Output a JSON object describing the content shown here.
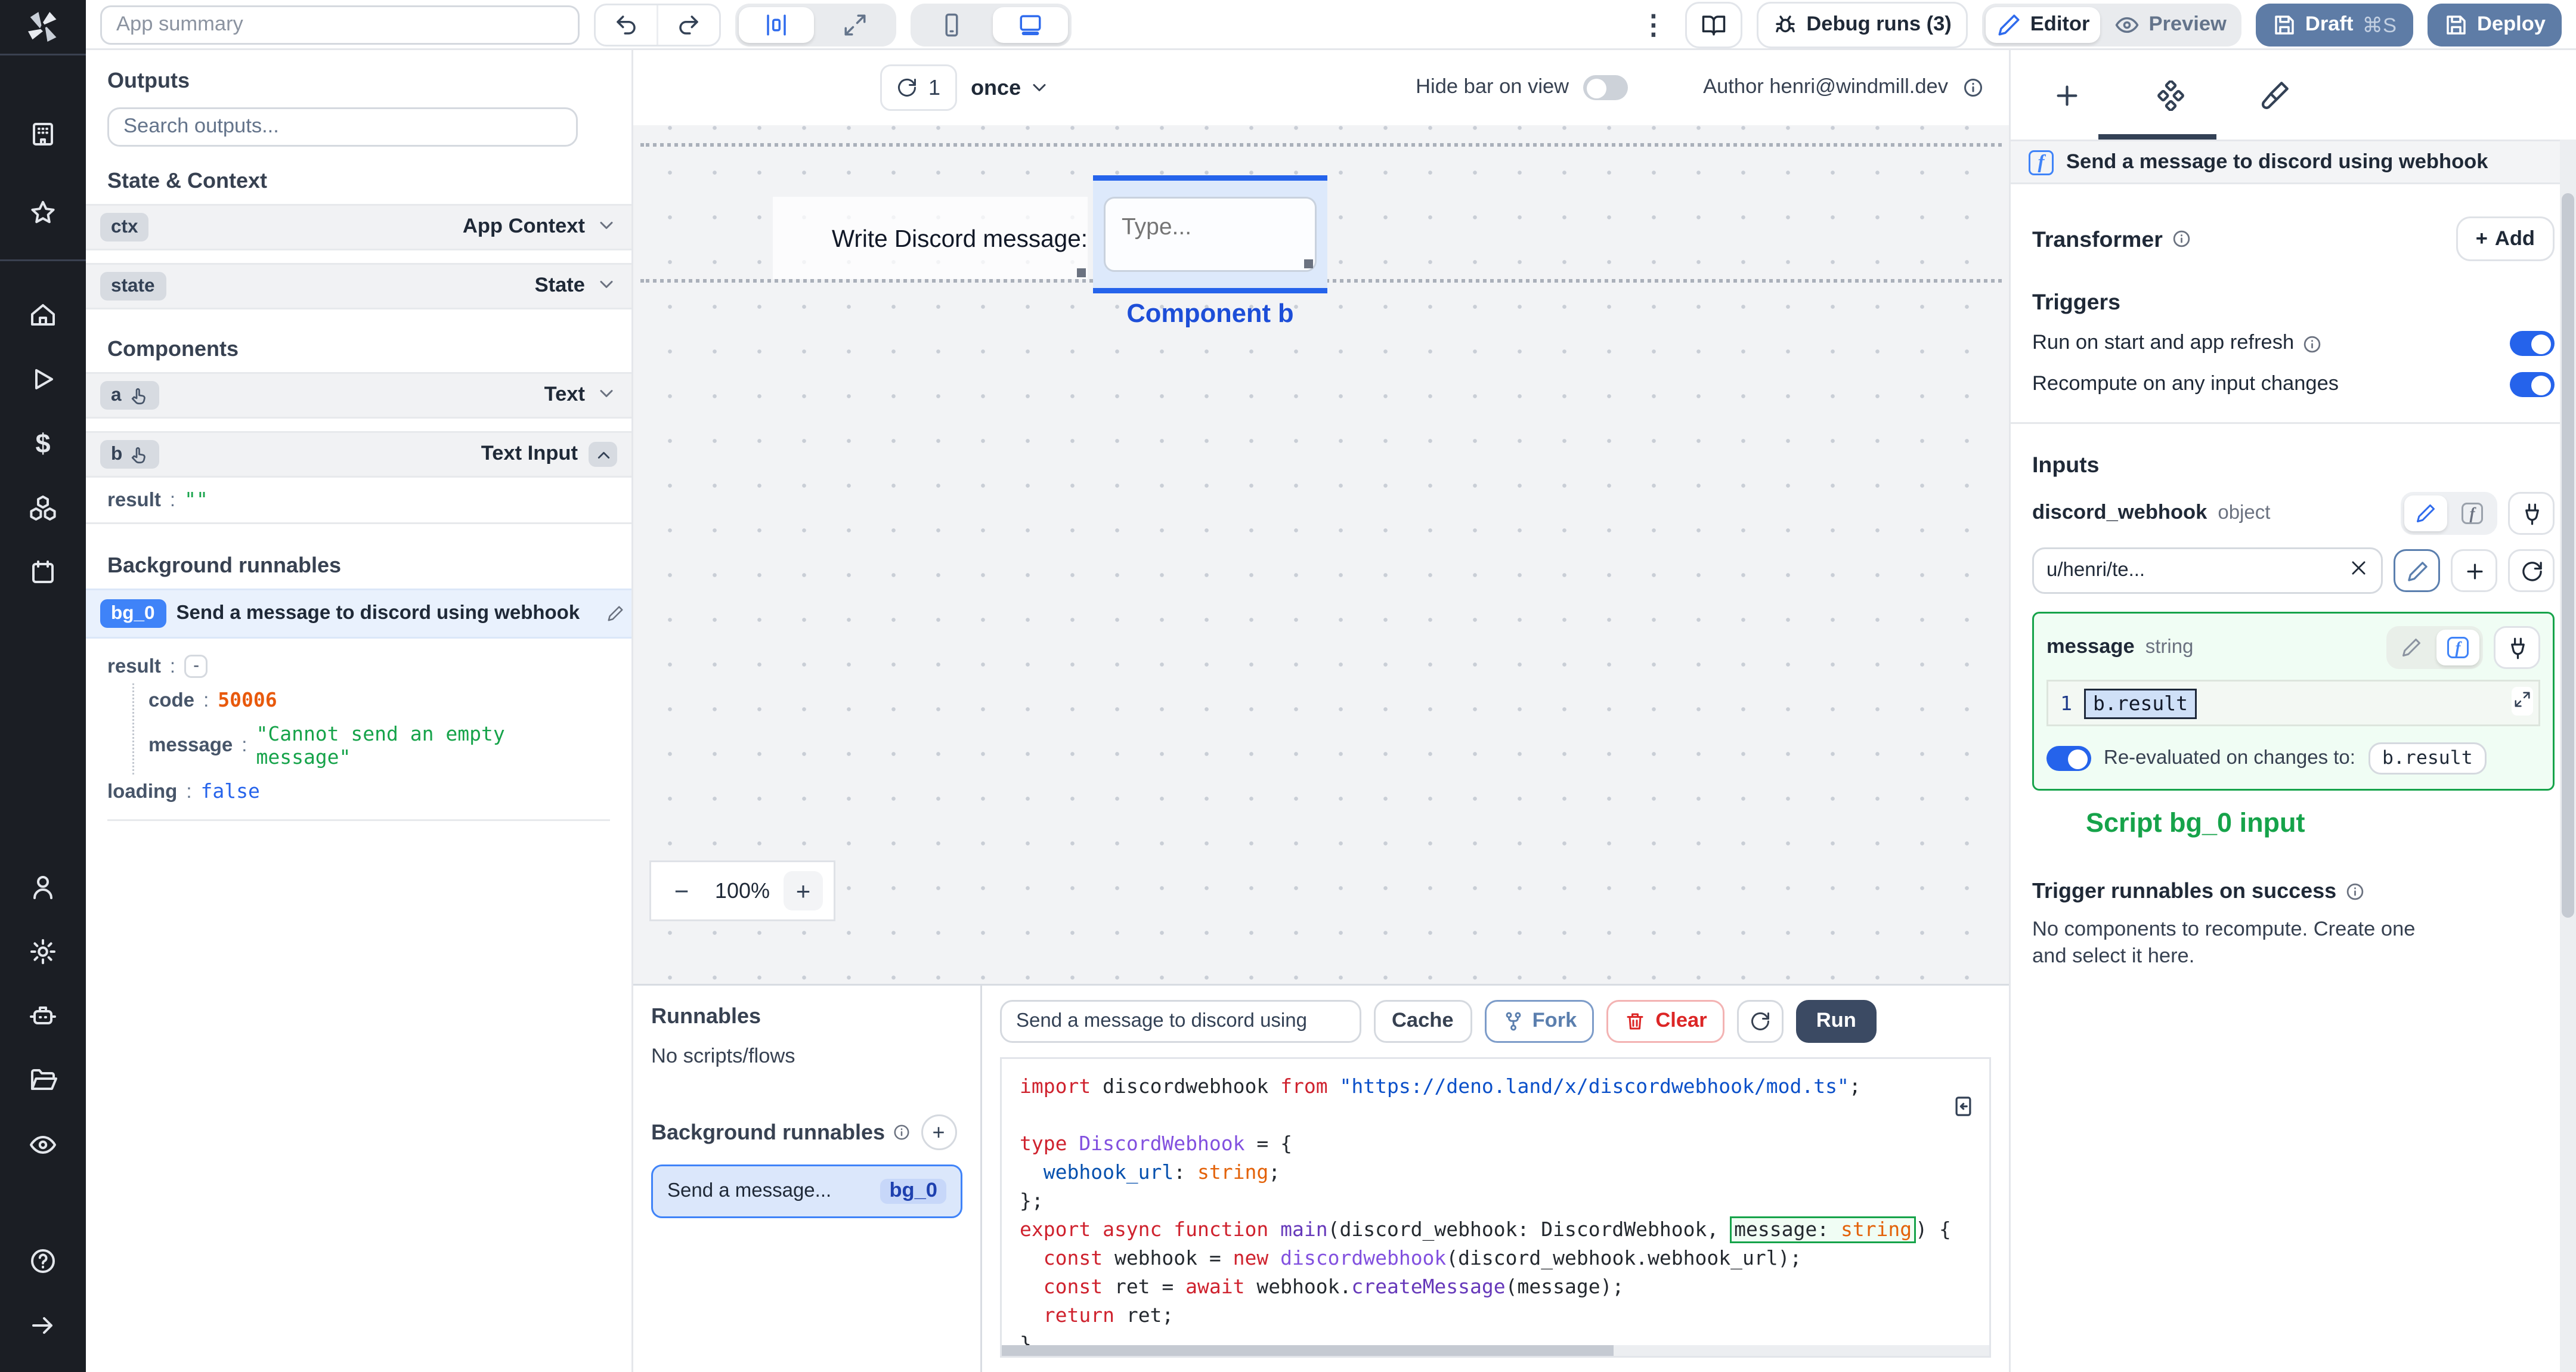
{
  "topbar": {
    "summary_placeholder": "App summary",
    "menu": "⋮",
    "debug_runs_label": "Debug runs (3)",
    "editor_label": "Editor",
    "preview_label": "Preview",
    "draft_label": "Draft",
    "draft_shortcut": "⌘S",
    "deploy_label": "Deploy"
  },
  "left_panel": {
    "outputs_title": "Outputs",
    "search_placeholder": "Search outputs...",
    "state_context_title": "State & Context",
    "ctx": {
      "id": "ctx",
      "type": "App Context"
    },
    "state": {
      "id": "state",
      "type": "State"
    },
    "components_title": "Components",
    "comp_a": {
      "id": "a",
      "type": "Text"
    },
    "comp_b": {
      "id": "b",
      "type": "Text Input"
    },
    "comp_b_result": {
      "key": "result",
      "colon": ":",
      "value": "\"\""
    },
    "background_title": "Background runnables",
    "bg": {
      "badge": "bg_0",
      "title": "Send a message to discord using webhook"
    },
    "bg_result": {
      "key": "result",
      "colon": ":",
      "value": "-"
    },
    "bg_code": {
      "key": "code",
      "colon": ":",
      "value": "50006"
    },
    "bg_message": {
      "key": "message",
      "colon": ":",
      "value": "\"Cannot send an empty message\""
    },
    "bg_loading": {
      "key": "loading",
      "colon": ":",
      "value": "false"
    }
  },
  "canvas": {
    "refresh_count": "1",
    "schedule": "once",
    "hide_bar_label": "Hide bar on view",
    "author_label": "Author henri@windmill.dev",
    "text_component": "Write Discord message:",
    "input_placeholder": "Type...",
    "selected_label": "Component b",
    "zoom_out": "−",
    "zoom_level": "100%",
    "zoom_in": "+"
  },
  "runnables": {
    "title": "Runnables",
    "empty": "No scripts/flows",
    "background_title": "Background runnables",
    "item_label": "Send a message...",
    "item_badge": "bg_0"
  },
  "editor": {
    "script_name": "Send a message to discord using",
    "cache_label": "Cache",
    "fork_label": "Fork",
    "clear_label": "Clear",
    "run_label": "Run"
  },
  "code": {
    "lines": [
      [
        [
          "k",
          "import"
        ],
        [
          "p",
          " discordwebhook "
        ],
        [
          "k",
          "from"
        ],
        [
          "s",
          " \"https://deno.land/x/discordwebhook/mod.ts\""
        ],
        [
          "p",
          ";"
        ]
      ],
      [],
      [
        [
          "k",
          "type"
        ],
        [
          "t",
          " DiscordWebhook"
        ],
        [
          "p",
          " = {"
        ]
      ],
      [
        [
          "v",
          "  webhook_url"
        ],
        [
          "p",
          ": "
        ],
        [
          "ty",
          "string"
        ],
        [
          "p",
          ";"
        ]
      ],
      [
        [
          "p",
          "};"
        ]
      ],
      [
        [
          "k",
          "export async function"
        ],
        [
          "fn",
          " main"
        ],
        [
          "p",
          "(discord_webhook: DiscordWebhook, "
        ],
        [
          "group",
          [
            [
              "p",
              "message: "
            ],
            [
              "ty",
              "string"
            ]
          ]
        ],
        [
          "p",
          ") {"
        ]
      ],
      [
        [
          "k",
          "  const"
        ],
        [
          "p",
          " webhook = "
        ],
        [
          "k",
          "new"
        ],
        [
          "t",
          " discordwebhook"
        ],
        [
          "p",
          "(discord_webhook.webhook_url);"
        ]
      ],
      [
        [
          "k",
          "  const"
        ],
        [
          "p",
          " ret = "
        ],
        [
          "k",
          "await"
        ],
        [
          "p",
          " webhook."
        ],
        [
          "fn",
          "createMessage"
        ],
        [
          "p",
          "(message);"
        ]
      ],
      [
        [
          "k",
          "  return"
        ],
        [
          "p",
          " ret;"
        ]
      ],
      [
        [
          "p",
          "}"
        ]
      ]
    ]
  },
  "right_panel": {
    "header_title": "Send a message to discord using webhook",
    "transformer_label": "Transformer",
    "add_label": "Add",
    "triggers_title": "Triggers",
    "trigger_run_on_start": "Run on start and app refresh",
    "trigger_recompute": "Recompute on any input changes",
    "inputs_title": "Inputs",
    "discord_webhook": {
      "name": "discord_webhook",
      "type": "object",
      "value": "u/henri/te..."
    },
    "message": {
      "name": "message",
      "type": "string",
      "line_no": "1",
      "value": "b.result",
      "reeval_label": "Re-evaluated on changes to:",
      "reeval_value": "b.result"
    },
    "annotation": "Script bg_0 input",
    "success_title": "Trigger runnables on success",
    "success_text": "No components to recompute. Create one and select it here."
  },
  "colors": {
    "accent_blue": "#2563eb",
    "badge_blue": "#3f83f8",
    "green": "#16a34a",
    "orange": "#e8590c",
    "slate_button": "#5e7ca6",
    "run_button": "#3b4a63",
    "red": "#dc2626"
  }
}
